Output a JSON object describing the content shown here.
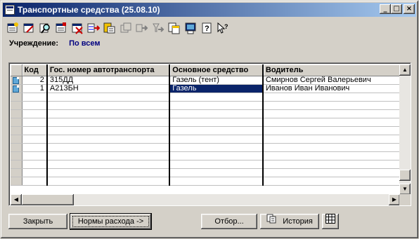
{
  "window": {
    "title": "Транспортные средства (25.08.10)",
    "minimize": "_",
    "maximize": "□",
    "close": "×"
  },
  "toolbar": {
    "icons": [
      "add-record-icon",
      "edit-record-icon",
      "find-icon",
      "copy-record-icon",
      "delete-record-icon",
      "insert-row-icon",
      "move-record-icon",
      "refresh-icon",
      "export-icon",
      "filter-icon",
      "copy-icon",
      "print-icon",
      "help-icon",
      "context-help-icon"
    ]
  },
  "institution": {
    "label": "Учреждение:",
    "value": "По всем"
  },
  "grid": {
    "columns": [
      "Код",
      "Гос. номер автотранспорта",
      "Основное средство",
      "Водитель"
    ],
    "rows": [
      {
        "code": "2",
        "plate": "315ДД",
        "asset": "Газель (тент)",
        "driver": "Смирнов Сергей Валерьевич"
      },
      {
        "code": "1",
        "plate": "А213БН",
        "asset": "Газель",
        "driver": "Иванов Иван Иванович"
      }
    ]
  },
  "buttons": {
    "close": "Закрыть",
    "norms": "Нормы расхода ->",
    "filter": "Отбор...",
    "history": "История"
  },
  "colors": {
    "title_start": "#0a246a",
    "title_end": "#a6caf0",
    "selection": "#0a246a",
    "institution_value": "#000080",
    "face": "#d4d0c8"
  }
}
